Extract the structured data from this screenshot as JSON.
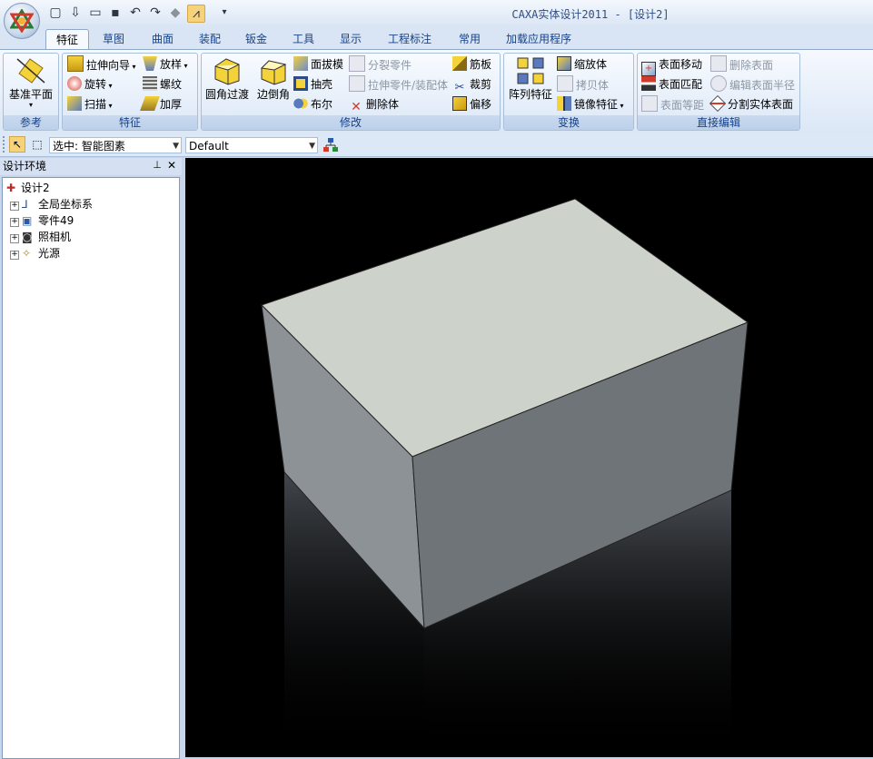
{
  "window": {
    "title": "CAXA实体设计2011 - [设计2]"
  },
  "quick_access": [
    "new-icon",
    "import-icon",
    "open-icon",
    "save-icon",
    "undo-icon",
    "redo-icon",
    "render-icon",
    "design-icon",
    "more-icon"
  ],
  "tabs": [
    "特征",
    "草图",
    "曲面",
    "装配",
    "钣金",
    "工具",
    "显示",
    "工程标注",
    "常用",
    "加载应用程序"
  ],
  "active_tab": "特征",
  "ribbon": {
    "reference": {
      "label": "参考",
      "datum_plane": "基准平面"
    },
    "features": {
      "label": "特征",
      "extrude": "拉伸向导",
      "revolve": "旋转",
      "sweep": "扫描",
      "loft": "放样",
      "thread": "螺纹",
      "thicken": "加厚"
    },
    "modify": {
      "label": "修改",
      "fillet": "圆角过渡",
      "chamfer": "边倒角",
      "draft": "面拔模",
      "shell": "抽壳",
      "boolean": "布尔",
      "split_part": "分裂零件",
      "extrude_to_part": "拉伸零件/装配体",
      "delete_body": "删除体",
      "rib": "筋板",
      "trim": "裁剪",
      "offset": "偏移"
    },
    "transform": {
      "label": "变换",
      "pattern": "阵列特征",
      "scale": "缩放体",
      "copy": "拷贝体",
      "mirror": "镜像特征"
    },
    "direct_edit": {
      "label": "直接编辑",
      "move_face": "表面移动",
      "match_face": "表面匹配",
      "face_distance": "表面等距",
      "delete_face": "删除表面",
      "edit_radius": "编辑表面半径",
      "split_face": "分割实体表面"
    }
  },
  "selection_toolbar": {
    "filter_value": "选中: 智能图素",
    "config_value": "Default"
  },
  "design_env": {
    "title": "设计环境",
    "tree": [
      {
        "label": "设计2",
        "icon": "design-icon",
        "expandable": false
      },
      {
        "label": "全局坐标系",
        "icon": "axes-icon",
        "expandable": true
      },
      {
        "label": "零件49",
        "icon": "part-icon",
        "expandable": true
      },
      {
        "label": "照相机",
        "icon": "camera-icon",
        "expandable": true
      },
      {
        "label": "光源",
        "icon": "light-icon",
        "expandable": true
      }
    ]
  },
  "colors": {
    "ribbon_text": "#15428b",
    "viewport_bg": "#000000",
    "box_top": "#cdd2cb",
    "box_left": "#8d9297",
    "box_front": "#6f7478"
  }
}
